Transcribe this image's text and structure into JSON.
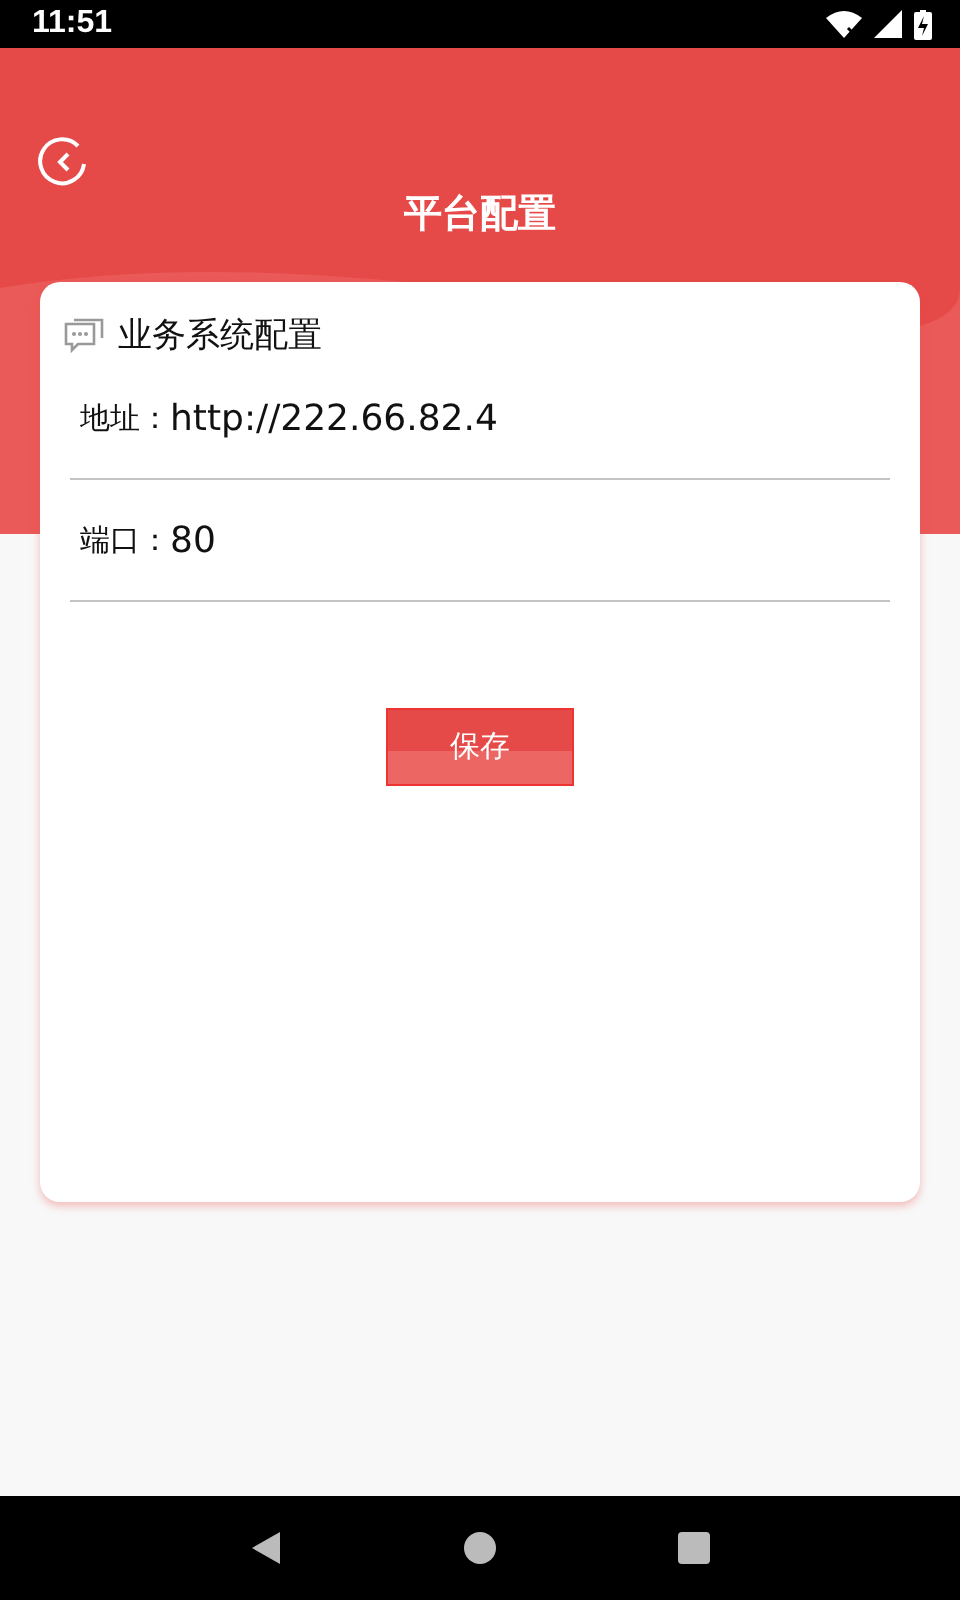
{
  "status_bar": {
    "time": "11:51"
  },
  "header": {
    "title": "平台配置"
  },
  "card": {
    "title": "业务系统配置",
    "fields": [
      {
        "label": "地址：",
        "value": "http://222.66.82.4"
      },
      {
        "label": "端口：",
        "value": "80"
      }
    ],
    "button": "保存"
  }
}
